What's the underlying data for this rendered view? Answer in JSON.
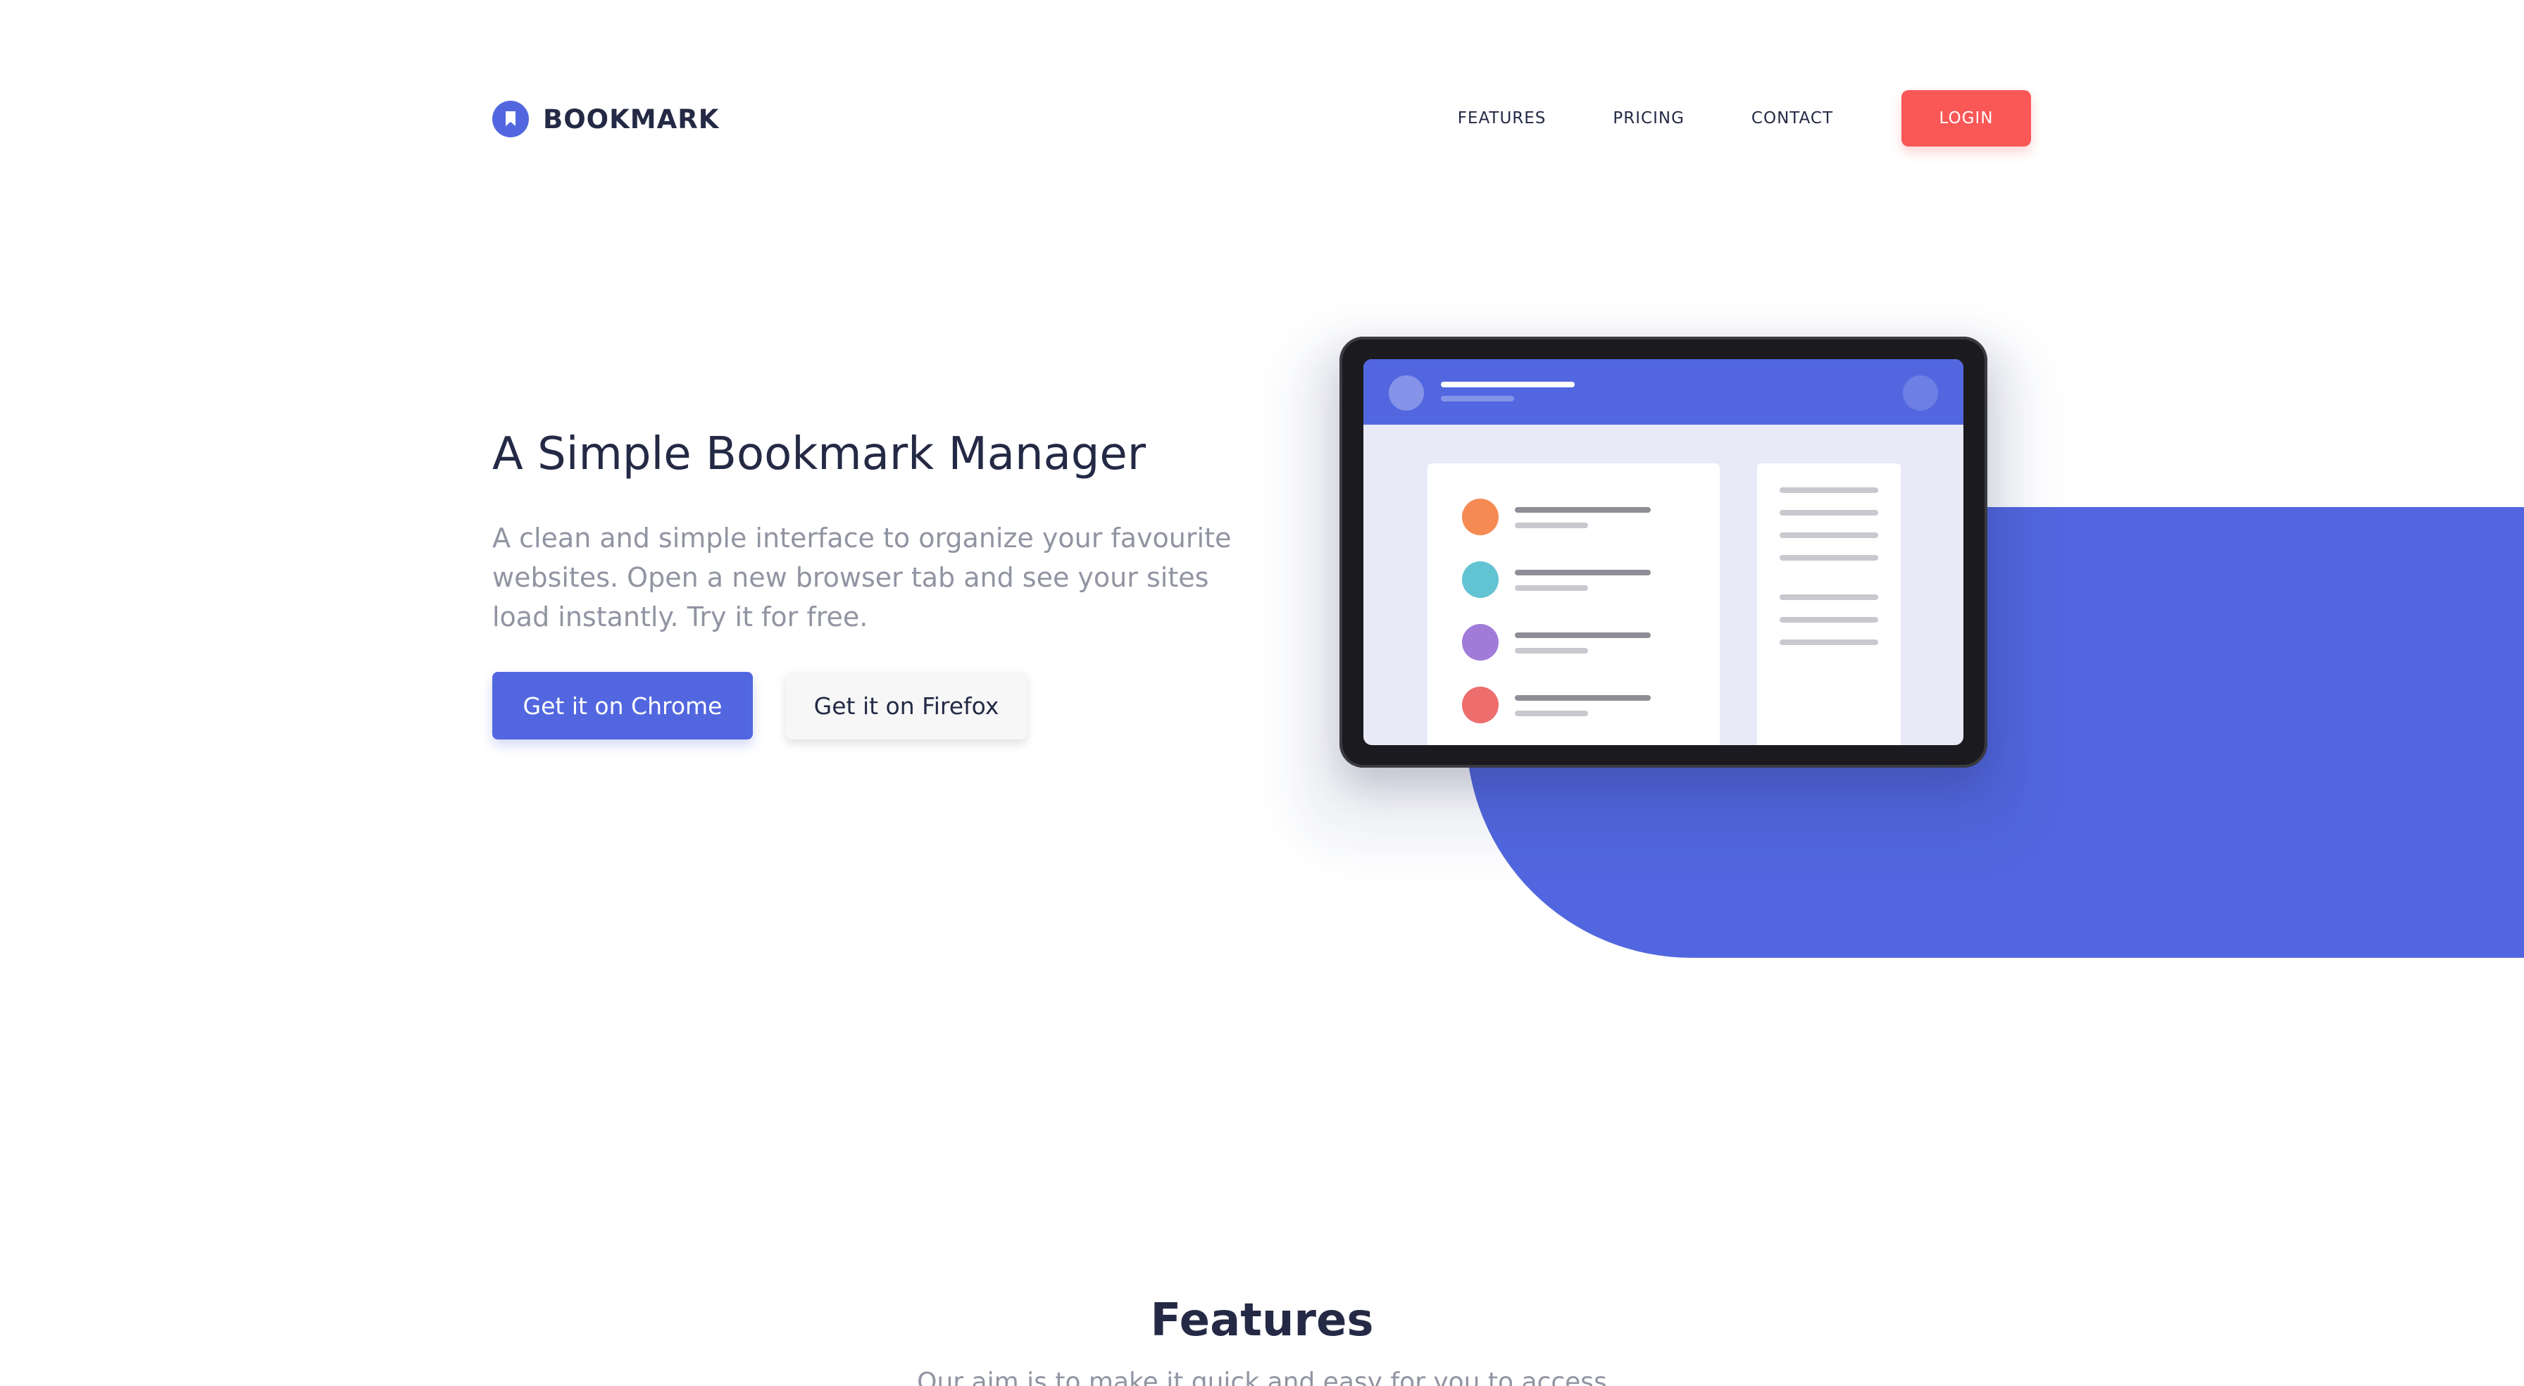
{
  "header": {
    "logo_text": "BOOKMARK",
    "nav": {
      "features": "FEATURES",
      "pricing": "PRICING",
      "contact": "CONTACT",
      "login": "LOGIN"
    }
  },
  "hero": {
    "title": "A Simple Bookmark Manager",
    "subtitle": "A clean and simple interface to organize your favourite websites. Open a new browser tab and see your sites load instantly. Try it for free.",
    "chrome_button": "Get it on Chrome",
    "firefox_button": "Get it on Firefox"
  },
  "illustration": {
    "list_dot_colors": [
      "#f58a53",
      "#62c3d3",
      "#a07bd8",
      "#ee6d6d"
    ]
  },
  "features": {
    "title": "Features",
    "subtitle": "Our aim is to make it quick and easy for you to access"
  },
  "colors": {
    "primary": "#5267df",
    "accent": "#fa5757",
    "heading": "#242a45",
    "muted": "#9194a2"
  }
}
